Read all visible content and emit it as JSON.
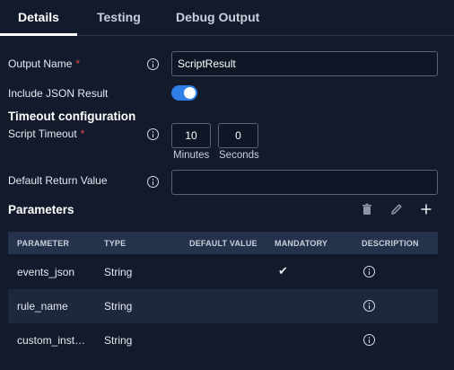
{
  "tabs": [
    {
      "label": "Details"
    },
    {
      "label": "Testing"
    },
    {
      "label": "Debug Output"
    }
  ],
  "form": {
    "output_name_label": "Output Name",
    "required_mark": "*",
    "output_name_value": "ScriptResult",
    "include_json_label": "Include JSON Result",
    "include_json_enabled": true,
    "timeout_section_title": "Timeout configuration",
    "script_timeout_label": "Script Timeout",
    "timeout_minutes_value": "10",
    "timeout_seconds_value": "0",
    "minutes_label": "Minutes",
    "seconds_label": "Seconds",
    "default_return_label": "Default Return Value",
    "default_return_value": ""
  },
  "parameters": {
    "title": "Parameters",
    "toolbar_icons": [
      "trash-icon",
      "pencil-icon",
      "plus-icon"
    ],
    "columns": [
      "PARAMETER",
      "TYPE",
      "DEFAULT VALUE",
      "MANDATORY",
      "DESCRIPTION"
    ],
    "rows": [
      {
        "parameter": "events_json",
        "type": "String",
        "default_value": "",
        "mandatory": true
      },
      {
        "parameter": "rule_name",
        "type": "String",
        "default_value": "",
        "mandatory": false
      },
      {
        "parameter": "custom_inst…",
        "type": "String",
        "default_value": "",
        "mandatory": false
      }
    ]
  },
  "colors": {
    "background": "#121a2b",
    "accent": "#2f7fe6",
    "required": "#e5484d",
    "table_header": "#25324b"
  }
}
